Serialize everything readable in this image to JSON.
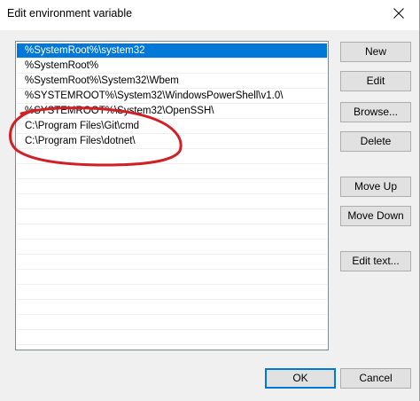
{
  "window": {
    "title": "Edit environment variable"
  },
  "list": {
    "items": [
      "%SystemRoot%\\system32",
      "%SystemRoot%",
      "%SystemRoot%\\System32\\Wbem",
      "%SYSTEMROOT%\\System32\\WindowsPowerShell\\v1.0\\",
      "%SYSTEMROOT%\\System32\\OpenSSH\\",
      "C:\\Program Files\\Git\\cmd",
      "C:\\Program Files\\dotnet\\"
    ],
    "selected_index": 0
  },
  "buttons": {
    "new_label": "New",
    "edit_label": "Edit",
    "browse_label": "Browse...",
    "delete_label": "Delete",
    "move_up_label": "Move Up",
    "move_down_label": "Move Down",
    "edit_text_label": "Edit text...",
    "ok_label": "OK",
    "cancel_label": "Cancel"
  },
  "colors": {
    "selection": "#0078d7",
    "annotation": "#d21f26",
    "window_bg": "#f0f0f0"
  }
}
